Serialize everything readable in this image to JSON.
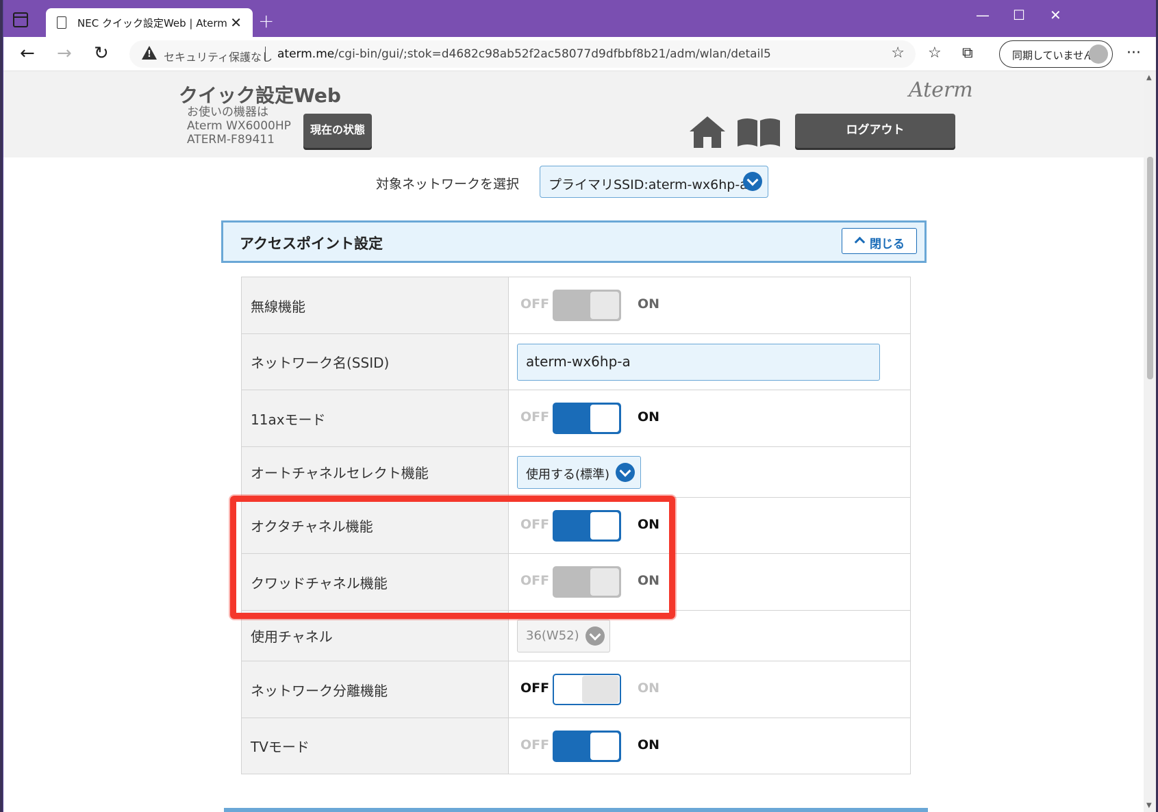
{
  "browser": {
    "tab_title": "NEC クイック設定Web | Aterm",
    "security_label": "セキュリティ保護なし",
    "url_domain": "aterm.me",
    "url_path": "/cgi-bin/gui/;stok=d4682c98ab52f2ac58077d9dfbbf8b21/adm/wlan/detail5",
    "profile_label": "同期していません",
    "icons": [
      "tab-list-icon",
      "page-icon",
      "close-icon",
      "plus-icon",
      "back-icon",
      "forward-icon",
      "refresh-icon",
      "warning-icon",
      "add-favorite-icon",
      "favorites-icon",
      "collections-icon",
      "avatar-icon",
      "more-icon",
      "minimize-icon",
      "maximize-icon",
      "window-close-icon"
    ]
  },
  "header": {
    "site_title": "クイック設定Web",
    "device_caption": "お使いの機器は",
    "device_model": "Aterm WX6000HP",
    "device_id": "ATERM-F89411",
    "status_button": "現在の状態",
    "logo": "Aterm",
    "logout_button": "ログアウト"
  },
  "network_select": {
    "label": "対象ネットワークを選択",
    "value": "プライマリSSID:aterm-wx6hp-a"
  },
  "section": {
    "title": "アクセスポイント設定",
    "close_button": "閉じる"
  },
  "toggle_labels": {
    "off": "OFF",
    "on": "ON"
  },
  "rows": [
    {
      "label": "無線機能",
      "type": "toggle",
      "state": "on-disabled"
    },
    {
      "label": "ネットワーク名(SSID)",
      "type": "text",
      "value": "aterm-wx6hp-a"
    },
    {
      "label": "11axモード",
      "type": "toggle",
      "state": "on"
    },
    {
      "label": "オートチャネルセレクト機能",
      "type": "select",
      "value": "使用する(標準)"
    },
    {
      "label": "オクタチャネル機能",
      "type": "toggle",
      "state": "on"
    },
    {
      "label": "クワッドチャネル機能",
      "type": "toggle",
      "state": "on-disabled"
    },
    {
      "label": "使用チャネル",
      "type": "select-disabled",
      "value": "36(W52)"
    },
    {
      "label": "ネットワーク分離機能",
      "type": "toggle",
      "state": "off"
    },
    {
      "label": "TVモード",
      "type": "toggle",
      "state": "on"
    }
  ],
  "colors": {
    "titlebar": "#7a4fb1",
    "accent_blue": "#1a6cb8",
    "highlight_red": "#f4372b"
  }
}
